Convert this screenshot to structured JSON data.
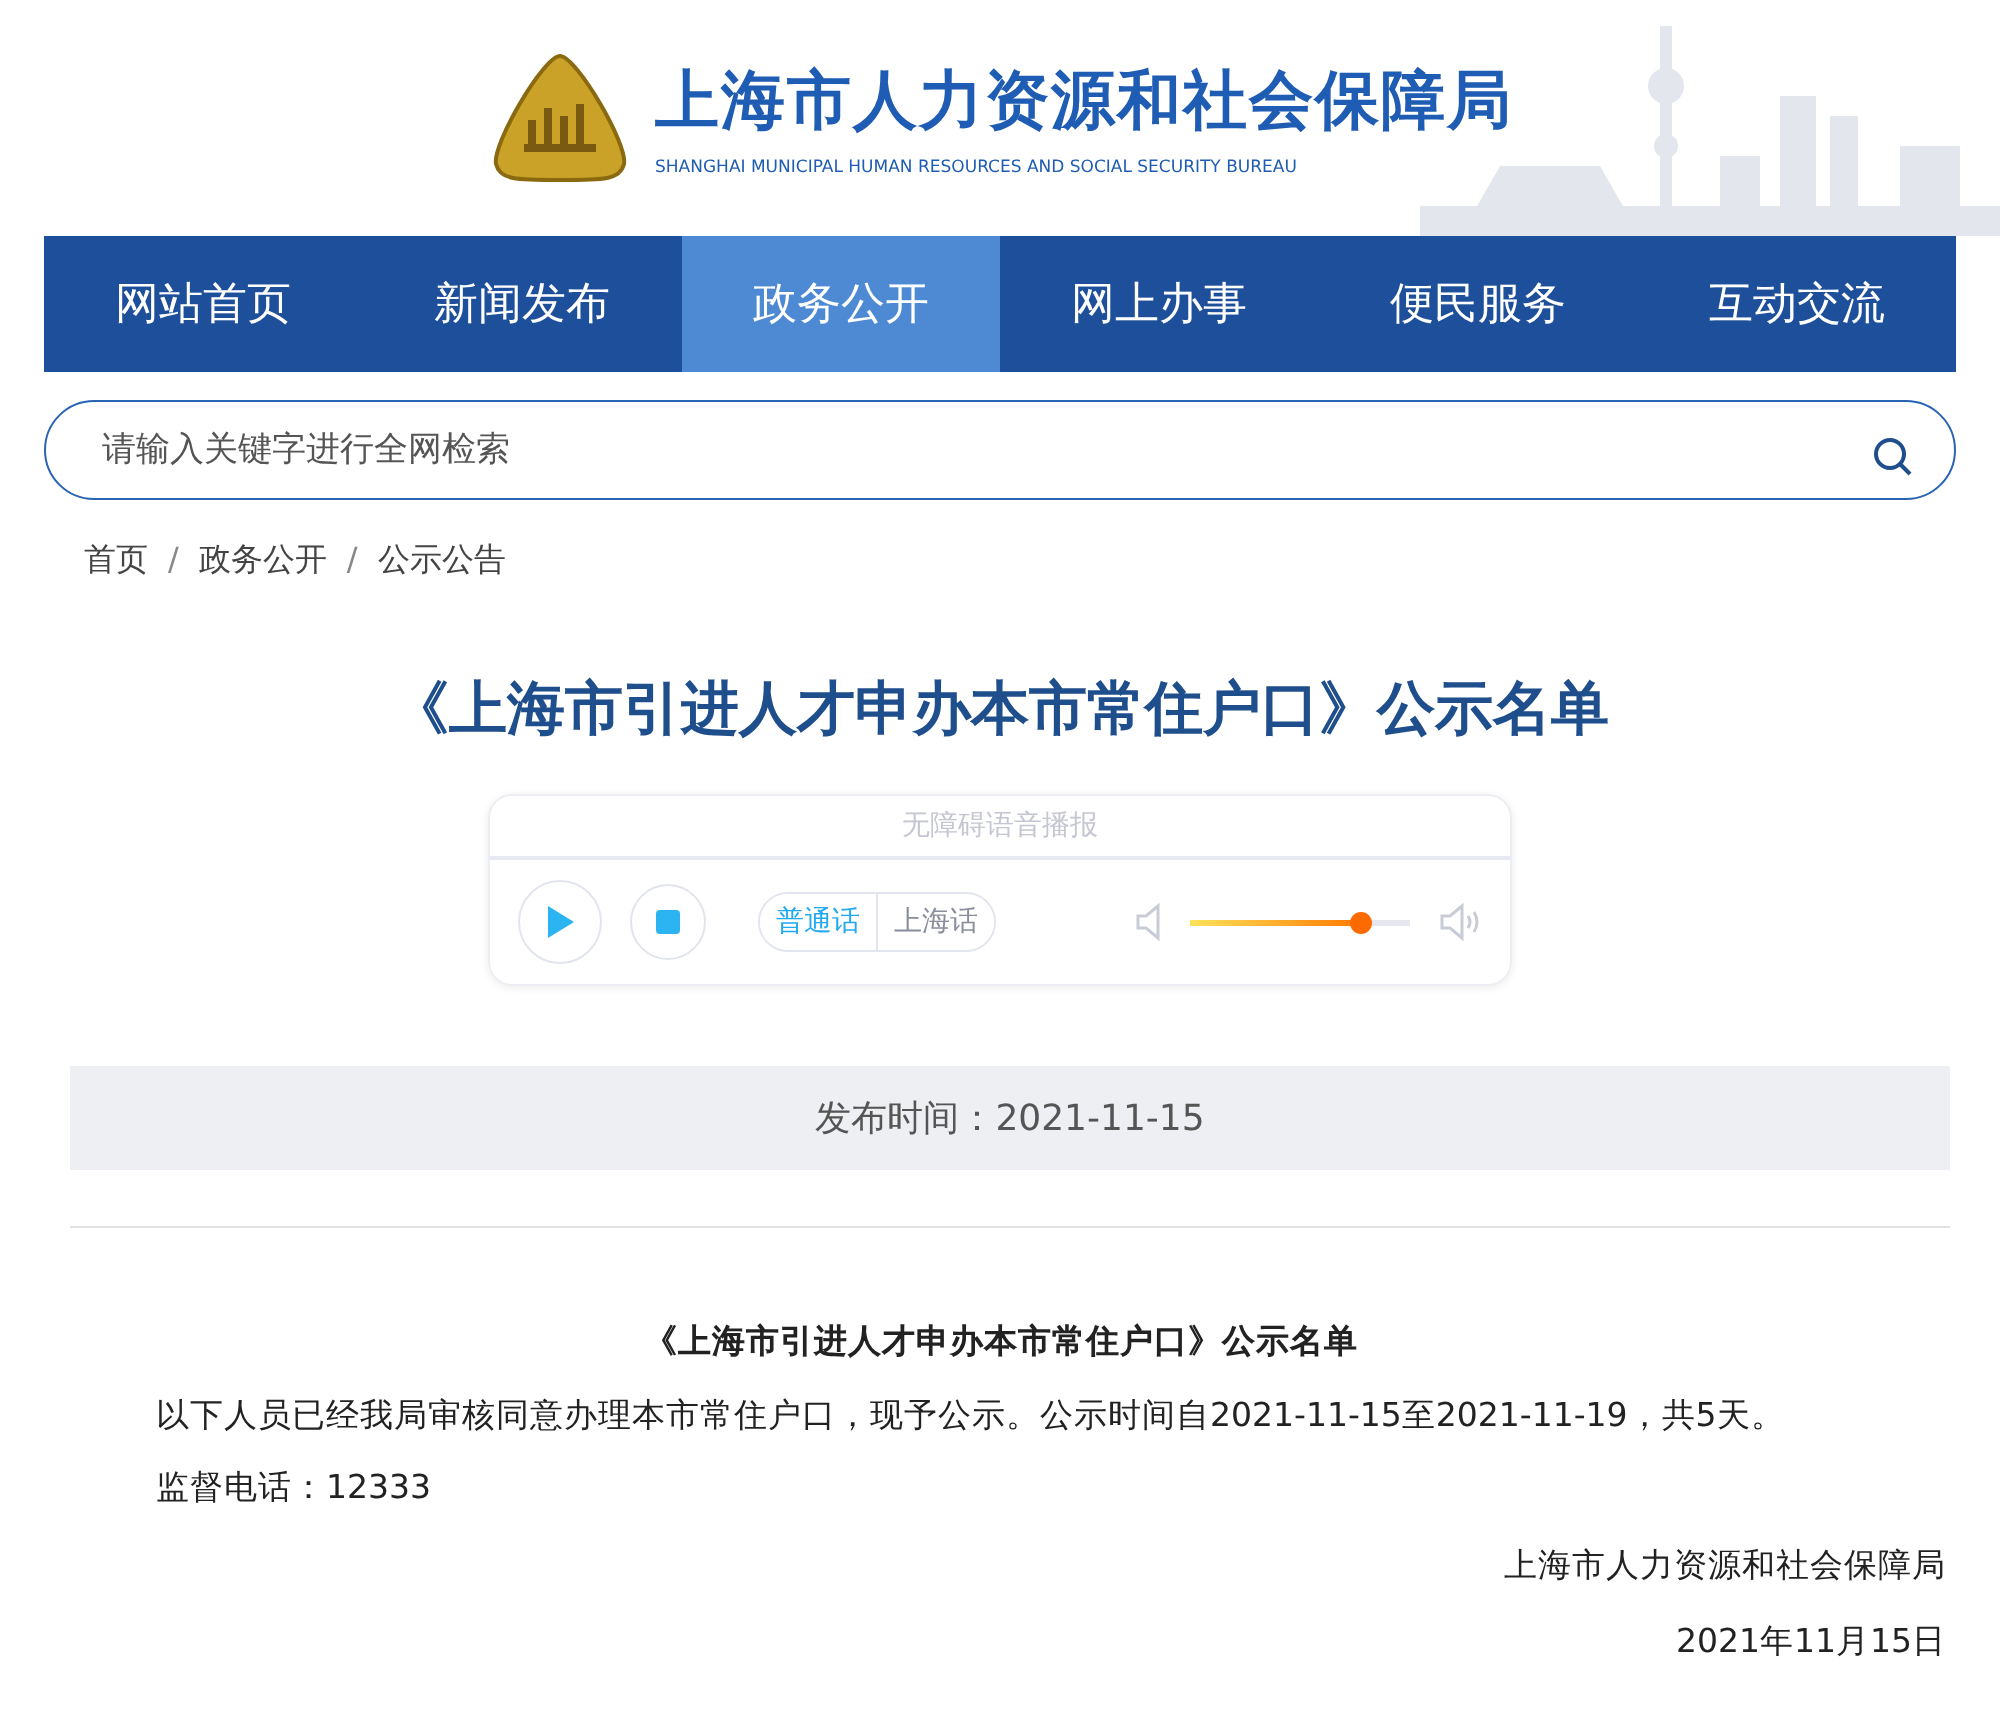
{
  "header": {
    "title": "上海市人力资源和社会保障局",
    "subtitle": "SHANGHAI MUNICIPAL HUMAN RESOURCES AND SOCIAL SECURITY BUREAU"
  },
  "nav": [
    {
      "label": "网站首页",
      "selected": false
    },
    {
      "label": "新闻发布",
      "selected": false
    },
    {
      "label": "政务公开",
      "selected": true
    },
    {
      "label": "网上办事",
      "selected": false
    },
    {
      "label": "便民服务",
      "selected": false
    },
    {
      "label": "互动交流",
      "selected": false
    }
  ],
  "search": {
    "placeholder": "请输入关键字进行全网检索"
  },
  "breadcrumb": [
    "首页",
    "政务公开",
    "公示公告"
  ],
  "breadcrumb_separator": "/",
  "title": "《上海市引进人才申办本市常住户口》公示名单",
  "player": {
    "heading": "无障碍语音播报",
    "dialects": [
      {
        "label": "普通话",
        "selected": true
      },
      {
        "label": "上海话",
        "selected": false
      }
    ],
    "volume": {
      "level": 0.77
    }
  },
  "publish_date": "发布时间：2021-11-15",
  "article": {
    "heading": "《上海市引进人才申办本市常住户口》公示名单",
    "paragraphs": [
      "以下人员已经我局审核同意办理本市常住户口，现予公示。公示时间自2021-11-15至2021-11-19，共5天。",
      "监督电话：12333"
    ],
    "signature": "上海市人力资源和社会保障局",
    "date": "2021年11月15日"
  }
}
